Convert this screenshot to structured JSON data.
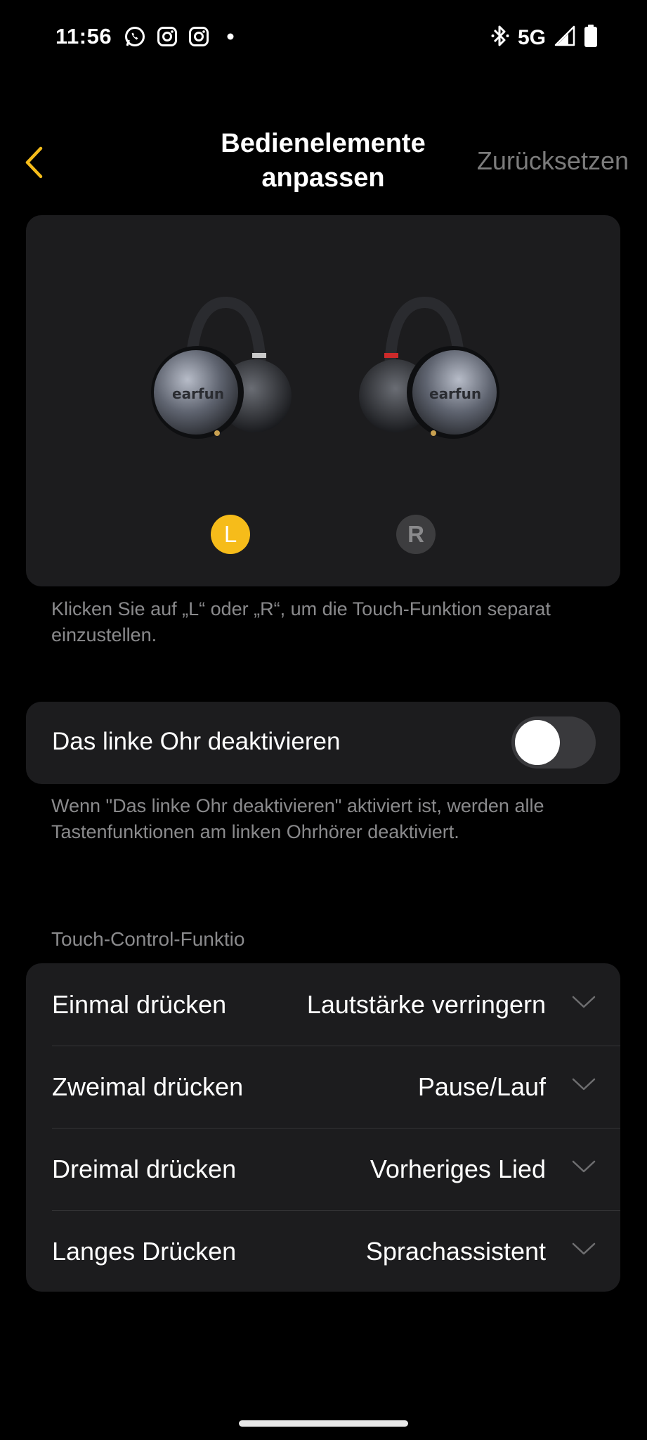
{
  "status_bar": {
    "time": "11:56",
    "network": "5G",
    "left_icons": [
      "whatsapp-icon",
      "instagram-icon",
      "instagram-icon",
      "dot-icon"
    ],
    "right_icons": [
      "bluetooth-icon",
      "signal-icon",
      "battery-icon"
    ]
  },
  "header": {
    "title_line1": "Bedienelemente",
    "title_line2": "anpassen",
    "reset_label": "Zurücksetzen",
    "back_icon": "chevron-left-icon"
  },
  "earbuds": {
    "left_label": "L",
    "right_label": "R",
    "left_logo": "earfun",
    "right_logo": "earfun",
    "selected": "L",
    "selected_color": "#f6bc1a"
  },
  "hint_select": "Klicken Sie auf „L“ oder „R“, um die Touch-Funktion separat einzustellen.",
  "disable_left": {
    "label": "Das linke Ohr deaktivieren",
    "enabled": false
  },
  "hint_disable": "Wenn \"Das linke Ohr deaktivieren\" aktiviert ist, werden alle Tastenfunktionen am linken Ohrhörer deaktiviert.",
  "controls": {
    "section_title": "Touch-Control-Funktio",
    "rows": [
      {
        "label": "Einmal drücken",
        "value": "Lautstärke verringern"
      },
      {
        "label": "Zweimal drücken",
        "value": "Pause/Lauf"
      },
      {
        "label": "Dreimal drücken",
        "value": "Vorheriges Lied"
      },
      {
        "label": "Langes Drücken",
        "value": "Sprachassistent"
      }
    ]
  },
  "colors": {
    "accent": "#f6bc1a",
    "background": "#000000",
    "card": "#1c1c1e",
    "secondary_text": "#8a8a8c"
  }
}
